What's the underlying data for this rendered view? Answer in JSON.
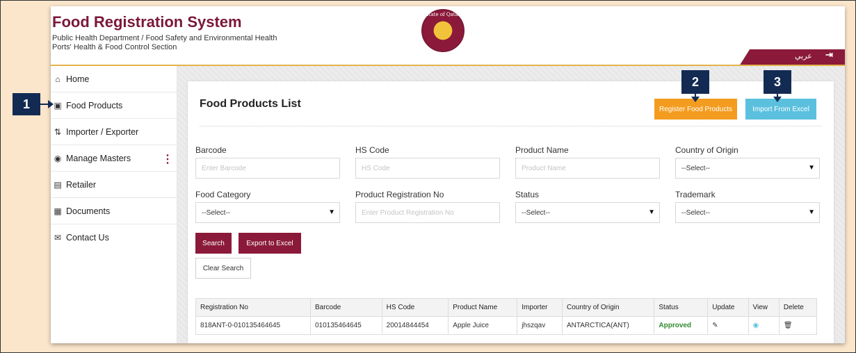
{
  "header": {
    "title": "Food Registration System",
    "subtitle1": "Public Health Department / Food Safety and Environmental Health",
    "subtitle2": "Ports' Health & Food Control Section",
    "emblem_text": "State of Qatar",
    "lang_label": "عربي",
    "logout_icon": "logout-icon"
  },
  "sidebar": {
    "items": [
      {
        "label": "Home",
        "icon": "home-icon"
      },
      {
        "label": "Food Products",
        "icon": "food-products-icon"
      },
      {
        "label": "Importer / Exporter",
        "icon": "import-export-icon"
      },
      {
        "label": "Manage Masters",
        "icon": "settings-icon"
      },
      {
        "label": "Retailer",
        "icon": "store-icon"
      },
      {
        "label": "Documents",
        "icon": "document-icon"
      },
      {
        "label": "Contact Us",
        "icon": "envelope-icon"
      }
    ]
  },
  "main": {
    "title": "Food Products List",
    "register_label": "Register Food Products",
    "import_label": "Import From Excel",
    "fields": {
      "barcode": {
        "label": "Barcode",
        "placeholder": "Enter Barcode"
      },
      "hs_code": {
        "label": "HS Code",
        "placeholder": "HS Code"
      },
      "product_name": {
        "label": "Product Name",
        "placeholder": "Product Name"
      },
      "country": {
        "label": "Country of Origin",
        "value": "--Select--"
      },
      "category": {
        "label": "Food Category",
        "value": "--Select--"
      },
      "reg_no": {
        "label": "Product Registration No",
        "placeholder": "Enter Product Registration No"
      },
      "status": {
        "label": "Status",
        "value": "--Select--"
      },
      "trademark": {
        "label": "Trademark",
        "value": "--Select--"
      }
    },
    "search_label": "Search",
    "export_label": "Export to Excel",
    "clear_label": "Clear Search",
    "table": {
      "headers": [
        "Registration No",
        "Barcode",
        "HS Code",
        "Product Name",
        "Importer",
        "Country of Origin",
        "Status",
        "Update",
        "View",
        "Delete"
      ],
      "rows": [
        {
          "reg_no": "818ANT-0-010135464645",
          "barcode": "010135464645",
          "hs_code": "20014844454",
          "product_name": "Apple Juice",
          "importer": "jhszqav",
          "country": "ANTARCTICA(ANT)",
          "status": "Approved"
        }
      ]
    }
  },
  "callouts": [
    "1",
    "2",
    "3"
  ],
  "colors": {
    "brand": "#8b1a3a",
    "accent_orange": "#f39c1f",
    "accent_blue": "#5bc0de",
    "callout": "#132a53",
    "approved": "#2e8b2e"
  }
}
